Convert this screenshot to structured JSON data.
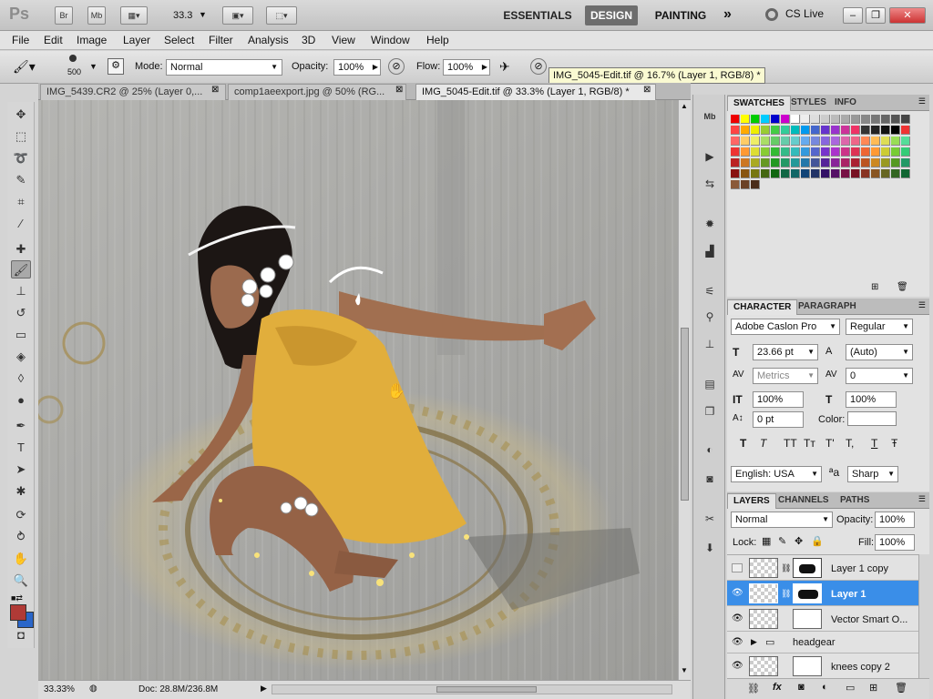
{
  "app": {
    "logo": "Ps",
    "zoom_display": "33.3",
    "mini_bridge": "Br",
    "mini_mb": "Mb",
    "workspaces": {
      "essentials": "ESSENTIALS",
      "design": "DESIGN",
      "painting": "PAINTING",
      "more": "»"
    },
    "cs_live": "CS Live",
    "window_buttons": {
      "minimize": "–",
      "restore": "❐",
      "close": "✕"
    }
  },
  "menu": [
    "File",
    "Edit",
    "Image",
    "Layer",
    "Select",
    "Filter",
    "Analysis",
    "3D",
    "View",
    "Window",
    "Help"
  ],
  "options": {
    "brush_size": "500",
    "mode_label": "Mode:",
    "mode_value": "Normal",
    "opacity_label": "Opacity:",
    "opacity_value": "100%",
    "flow_label": "Flow:",
    "flow_value": "100%",
    "tooltip": "IMG_5045-Edit.tif @ 16.7% (Layer 1, RGB/8) *"
  },
  "doc_tabs": [
    {
      "label": "IMG_5439.CR2 @ 25% (Layer 0,..."
    },
    {
      "label": "comp1aeexport.jpg @ 50% (RG..."
    },
    {
      "label": "IMG_5045-Edit.tif @ 33.3% (Layer 1, RGB/8) *"
    }
  ],
  "status": {
    "zoom": "33.33%",
    "doc": "Doc: 28.8M/236.8M"
  },
  "swatches_panel": {
    "tabs": [
      "SWATCHES",
      "STYLES",
      "INFO"
    ]
  },
  "character_panel": {
    "tabs": [
      "CHARACTER",
      "PARAGRAPH"
    ],
    "font_family": "Adobe Caslon Pro",
    "font_style": "Regular",
    "font_size": "23.66 pt",
    "leading": "(Auto)",
    "kerning": "Metrics",
    "tracking": "0",
    "vscale": "100%",
    "hscale": "100%",
    "baseline": "0 pt",
    "color_label": "Color:",
    "language": "English: USA",
    "aa_label": "a",
    "antialias": "Sharp",
    "style_buttons": [
      "T",
      "T",
      "TT",
      "Tт",
      "T'",
      "T,",
      "T",
      "Ŧ"
    ]
  },
  "layers_panel": {
    "tabs": [
      "LAYERS",
      "CHANNELS",
      "PATHS"
    ],
    "blend_mode": "Normal",
    "opacity_label": "Opacity:",
    "opacity": "100%",
    "lock_label": "Lock:",
    "fill_label": "Fill:",
    "fill": "100%",
    "layers": [
      {
        "name": "Layer 1 copy",
        "visible": false,
        "selected": false
      },
      {
        "name": "Layer 1",
        "visible": true,
        "selected": true
      },
      {
        "name": "Vector Smart O...",
        "visible": true,
        "selected": false
      },
      {
        "name": "headgear",
        "visible": true,
        "selected": false,
        "group": true
      },
      {
        "name": "knees copy 2",
        "visible": true,
        "selected": false
      }
    ]
  },
  "colors": {
    "accent": "#3a8ee8",
    "foreground": "#b03a36",
    "background": "#2a66c9"
  }
}
